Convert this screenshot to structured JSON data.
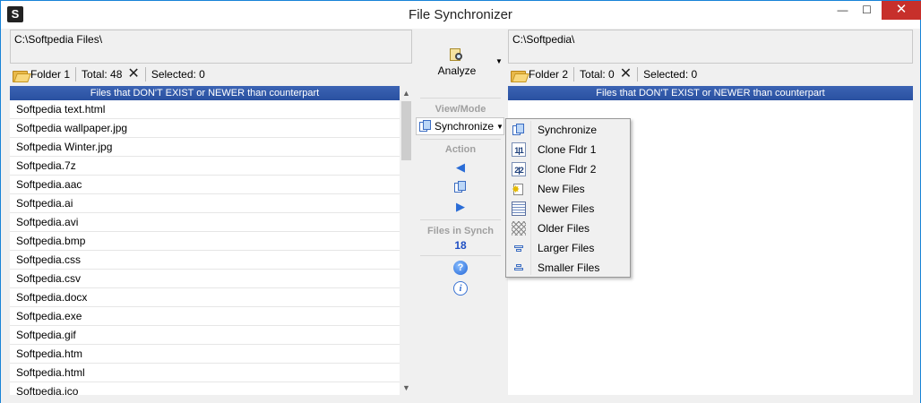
{
  "window": {
    "title": "File Synchronizer",
    "minimize": "—",
    "maximize": "☐",
    "close": "✕"
  },
  "left": {
    "path": "C:\\Softpedia Files\\",
    "folder_label": "Folder 1",
    "total": "Total: 48",
    "selected": "Selected: 0",
    "header": "Files that DON'T EXIST or NEWER than counterpart",
    "files": [
      "Softpedia text.html",
      "Softpedia wallpaper.jpg",
      "Softpedia Winter.jpg",
      "Softpedia.7z",
      "Softpedia.aac",
      "Softpedia.ai",
      "Softpedia.avi",
      "Softpedia.bmp",
      "Softpedia.css",
      "Softpedia.csv",
      "Softpedia.docx",
      "Softpedia.exe",
      "Softpedia.gif",
      "Softpedia.htm",
      "Softpedia.html",
      "Softpedia.ico"
    ]
  },
  "right": {
    "path": "C:\\Softpedia\\",
    "folder_label": "Folder 2",
    "total": "Total: 0",
    "selected": "Selected: 0",
    "header": "Files that DON'T EXIST or NEWER than counterpart"
  },
  "middle": {
    "analyze": "Analyze",
    "view_mode_label": "View/Mode",
    "mode_value": "Synchronize",
    "action_label": "Action",
    "files_in_synch_label": "Files in Synch",
    "files_in_synch_count": "18"
  },
  "mode_menu": {
    "items": [
      {
        "label": "Synchronize",
        "icon": "synchronize-icon"
      },
      {
        "label": "Clone Fldr 1",
        "icon": "clone-folder1-icon"
      },
      {
        "label": "Clone Fldr 2",
        "icon": "clone-folder2-icon"
      },
      {
        "label": "New Files",
        "icon": "new-files-icon"
      },
      {
        "label": "Newer Files",
        "icon": "newer-files-icon"
      },
      {
        "label": "Older Files",
        "icon": "older-files-icon"
      },
      {
        "label": "Larger Files",
        "icon": "larger-files-icon"
      },
      {
        "label": "Smaller Files",
        "icon": "smaller-files-icon"
      }
    ],
    "clone1_glyph": "1|1",
    "clone2_glyph": "2|2"
  }
}
